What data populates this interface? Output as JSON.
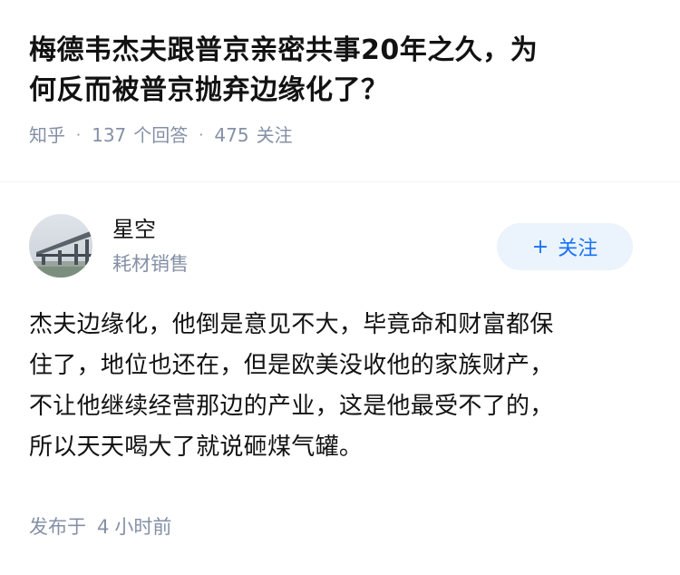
{
  "question": {
    "title_lines": [
      "梅德韦杰夫跟普京亲密共事20年之久，为",
      "何反而被普京抛弃边缘化了？"
    ],
    "source": "知乎",
    "answer_count": "137",
    "answer_label": "个回答",
    "follow_count": "475",
    "follow_label": "关注"
  },
  "author": {
    "name": "星空",
    "bio": "耗材销售",
    "avatar_icon": "avatar-bridge-photo",
    "follow_button": {
      "icon": "plus-icon",
      "label": "关注"
    }
  },
  "answer": {
    "lines": [
      "杰夫边缘化，他倒是意见不大，毕竟命和财富都保",
      "住了，地位也还在，但是欧美没收他的家族财产，",
      "不让他继续经营那边的产业，这是他最受不了的，",
      "所以天天喝大了就说砸煤气罐。"
    ],
    "published_prefix": "发布于",
    "published_num": "4",
    "published_suffix": "小时前"
  }
}
